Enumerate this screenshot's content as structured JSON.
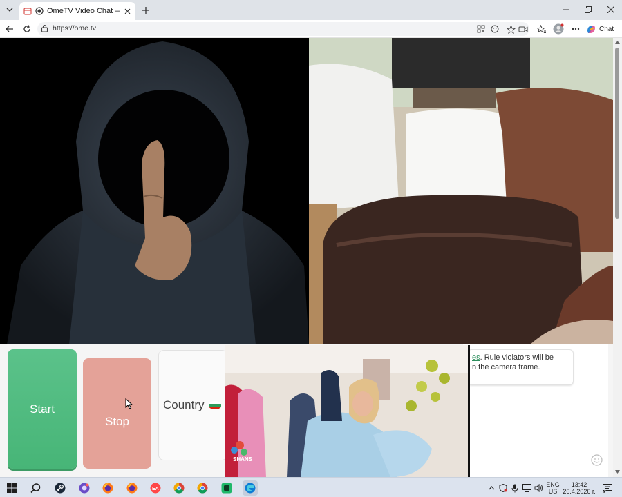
{
  "browser": {
    "tab_title": "OmeTV Video Chat — Omegle",
    "url": "https://ome.tv",
    "chat_label": "Chat"
  },
  "controls": {
    "start_label": "Start",
    "stop_label": "Stop",
    "country_label": "Country"
  },
  "chat": {
    "message_link": "es",
    "message_part1": ". Rule violators will be",
    "message_part2": "n the camera frame."
  },
  "popup_video": {
    "watermark": "SHANS"
  },
  "taskbar": {
    "lang_top": "ENG",
    "lang_bottom": "US",
    "time": "13:42",
    "date": "26.4.2026 г."
  },
  "colors": {
    "start": "#4fba7e",
    "stop": "#e4a298",
    "accent": "#2c8f5d"
  }
}
